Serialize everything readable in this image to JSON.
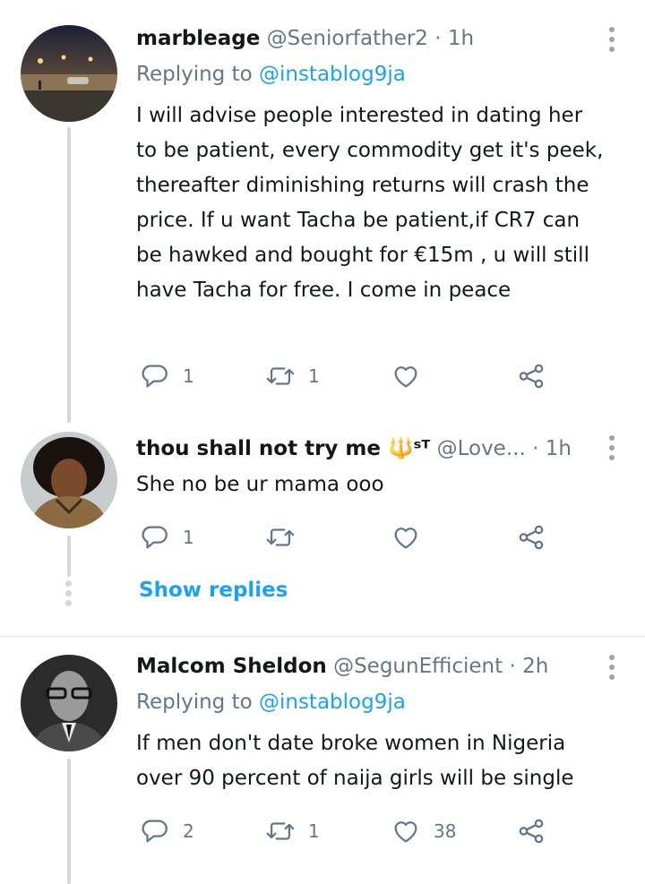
{
  "tweets": [
    {
      "name": "marbleage",
      "handle": "@Seniorfather2",
      "dot": "·",
      "time": "1h",
      "replying_label": "Replying to",
      "replying_to": "@instablog9ja",
      "text": "I will advise people interested in dating her to be patient, every commodity  get it's peek, thereafter diminishing returns will crash the price. If u want Tacha be patient,if CR7 can be hawked and  bought for €15m , u will still have Tacha for free. I come in peace",
      "reply_count": "1",
      "retweet_count": "1",
      "like_count": ""
    },
    {
      "name": "thou shall not try me 🔱ˢᵀ",
      "handle": "@Love...",
      "dot": "·",
      "time": "1h",
      "text": "She no be ur mama ooo",
      "reply_count": "1",
      "retweet_count": "",
      "like_count": ""
    },
    {
      "name": "Malcom Sheldon",
      "handle": "@SegunEfficient",
      "dot": "·",
      "time": "2h",
      "replying_label": "Replying to",
      "replying_to": "@instablog9ja",
      "text": "If men don't date broke women in Nigeria over 90 percent of naija girls will be single",
      "reply_count": "2",
      "retweet_count": "1",
      "like_count": "38"
    }
  ],
  "show_replies": "Show replies",
  "colors": {
    "accent": "#1da1f2",
    "secondary": "#657786",
    "icon": "#657786",
    "thread": "#cfd9de"
  },
  "icons": [
    "reply-icon",
    "retweet-icon",
    "like-icon",
    "share-icon",
    "more-icon"
  ]
}
